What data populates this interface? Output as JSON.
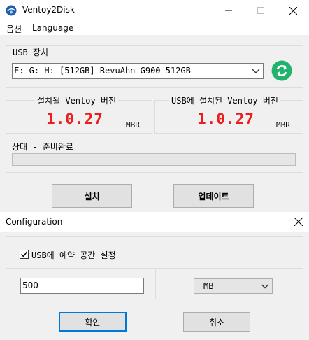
{
  "main": {
    "title": "Ventoy2Disk",
    "menu": {
      "options": "옵션",
      "language": "Language"
    },
    "usb_device": {
      "label": "USB 장치",
      "selected": "F: G: H: [512GB] RevuAhn G900 512GB"
    },
    "local_version": {
      "label": "설치될 Ventoy 버전",
      "value": "1.0.27",
      "partition": "MBR"
    },
    "device_version": {
      "label": "USB에 설치된 Ventoy 버전",
      "value": "1.0.27",
      "partition": "MBR"
    },
    "status": {
      "label": "상태 - 준비완료",
      "progress": 0
    },
    "buttons": {
      "install": "설치",
      "update": "업데이트"
    }
  },
  "config": {
    "title": "Configuration",
    "reserve_checkbox": {
      "label": "USB에 예약 공간 설정",
      "checked": true
    },
    "size_value": "500",
    "unit": "MB",
    "buttons": {
      "ok": "확인",
      "cancel": "취소"
    }
  },
  "colors": {
    "version_red": "#ee1c1c",
    "refresh_green": "#21b36b",
    "focus_blue": "#0078d7"
  }
}
